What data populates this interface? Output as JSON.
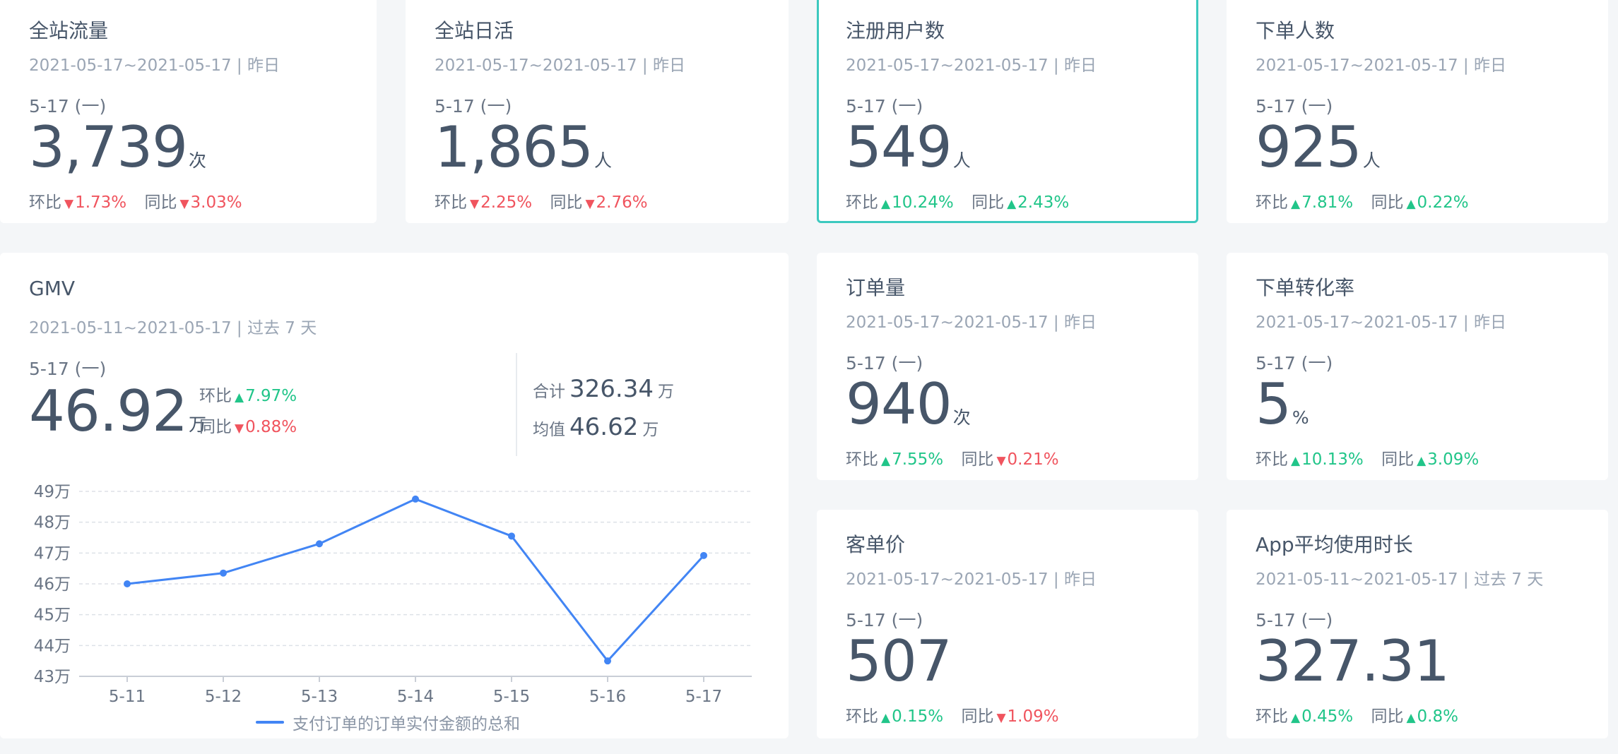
{
  "cards": [
    {
      "title": "全站流量",
      "range": "2021-05-17~2021-05-17 | 昨日",
      "date": "5-17 (一)",
      "value": "3,739",
      "unit": "次",
      "mom_label": "环比",
      "mom_dir": "down",
      "mom": "1.73%",
      "yoy_label": "同比",
      "yoy_dir": "down",
      "yoy": "3.03%"
    },
    {
      "title": "全站日活",
      "range": "2021-05-17~2021-05-17 | 昨日",
      "date": "5-17 (一)",
      "value": "1,865",
      "unit": "人",
      "mom_label": "环比",
      "mom_dir": "down",
      "mom": "2.25%",
      "yoy_label": "同比",
      "yoy_dir": "down",
      "yoy": "2.76%"
    },
    {
      "title": "注册用户数",
      "range": "2021-05-17~2021-05-17 | 昨日",
      "date": "5-17 (一)",
      "value": "549",
      "unit": "人",
      "mom_label": "环比",
      "mom_dir": "up",
      "mom": "10.24%",
      "yoy_label": "同比",
      "yoy_dir": "up",
      "yoy": "2.43%"
    },
    {
      "title": "下单人数",
      "range": "2021-05-17~2021-05-17 | 昨日",
      "date": "5-17 (一)",
      "value": "925",
      "unit": "人",
      "mom_label": "环比",
      "mom_dir": "up",
      "mom": "7.81%",
      "yoy_label": "同比",
      "yoy_dir": "up",
      "yoy": "0.22%"
    },
    {
      "title": "订单量",
      "range": "2021-05-17~2021-05-17 | 昨日",
      "date": "5-17 (一)",
      "value": "940",
      "unit": "次",
      "mom_label": "环比",
      "mom_dir": "up",
      "mom": "7.55%",
      "yoy_label": "同比",
      "yoy_dir": "down",
      "yoy": "0.21%"
    },
    {
      "title": "下单转化率",
      "range": "2021-05-17~2021-05-17 | 昨日",
      "date": "5-17 (一)",
      "value": "5",
      "unit": "%",
      "mom_label": "环比",
      "mom_dir": "up",
      "mom": "10.13%",
      "yoy_label": "同比",
      "yoy_dir": "up",
      "yoy": "3.09%"
    },
    {
      "title": "客单价",
      "range": "2021-05-17~2021-05-17 | 昨日",
      "date": "5-17 (一)",
      "value": "507",
      "unit": "",
      "mom_label": "环比",
      "mom_dir": "up",
      "mom": "0.15%",
      "yoy_label": "同比",
      "yoy_dir": "down",
      "yoy": "1.09%"
    },
    {
      "title": "App平均使用时长",
      "range": "2021-05-11~2021-05-17 | 过去 7 天",
      "date": "5-17 (一)",
      "value": "327.31",
      "unit": "",
      "mom_label": "环比",
      "mom_dir": "up",
      "mom": "0.45%",
      "yoy_label": "同比",
      "yoy_dir": "up",
      "yoy": "0.8%"
    }
  ],
  "gmv": {
    "title": "GMV",
    "range": "2021-05-11~2021-05-17 | 过去 7 天",
    "date": "5-17 (一)",
    "value": "46.92",
    "unit": "万",
    "mom_label": "环比",
    "mom_dir": "up",
    "mom": "7.97%",
    "yoy_label": "同比",
    "yoy_dir": "down",
    "yoy": "0.88%",
    "total_label": "合计",
    "total": "326.34",
    "total_unit": "万",
    "avg_label": "均值",
    "avg": "46.62",
    "avg_unit": "万"
  },
  "colors": {
    "up": "#21c589",
    "down": "#f0545e",
    "line": "#4285f4",
    "active_border": "#3cc9bf"
  },
  "chart_data": {
    "type": "line",
    "categories": [
      "5-11",
      "5-12",
      "5-13",
      "5-14",
      "5-15",
      "5-16",
      "5-17"
    ],
    "series": [
      {
        "name": "支付订单的订单实付金额的总和",
        "values": [
          46.0,
          46.35,
          47.3,
          48.75,
          47.55,
          43.5,
          46.92
        ]
      }
    ],
    "y_ticks": [
      "49万",
      "48万",
      "47万",
      "46万",
      "45万",
      "44万",
      "43万"
    ],
    "ylim": [
      43,
      49
    ],
    "grid": true,
    "legend": "bottom"
  }
}
